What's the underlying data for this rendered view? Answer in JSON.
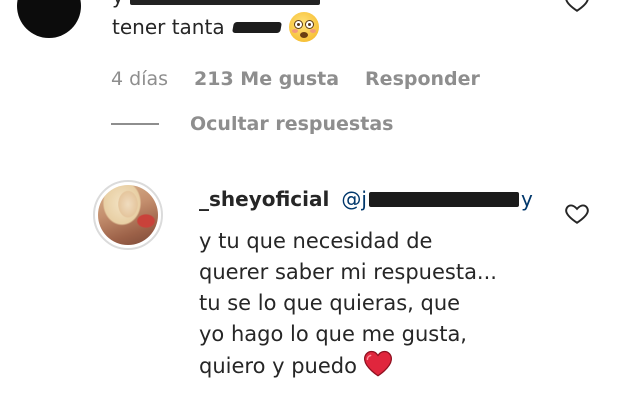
{
  "top_comment": {
    "partial_line": "y",
    "text": "tener tanta"
  },
  "meta": {
    "time": "4 días",
    "likes": "213 Me gusta",
    "reply": "Responder"
  },
  "hide_replies": "Ocultar respuestas",
  "reply": {
    "username": "_sheyoficial",
    "mention_prefix": "@j",
    "mention_suffix": "y",
    "lines": [
      "y tu que necesidad de",
      "querer saber mi respuesta...",
      "tu se lo que quieras, que",
      "yo hago lo que me gusta,",
      "quiero y puedo"
    ]
  },
  "icons": {
    "like": "heart-outline-icon",
    "emoji_flushed": "flushed-face-emoji",
    "emoji_heart": "red-heart-emoji"
  },
  "colors": {
    "text": "#262626",
    "muted": "#8e8e8e",
    "mention": "#00376b",
    "heart": "#e0263d"
  }
}
